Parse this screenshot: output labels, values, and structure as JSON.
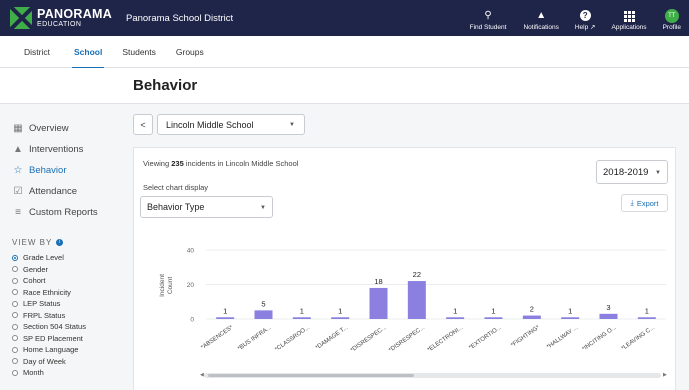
{
  "topbar": {
    "logo_main": "PANORAMA",
    "logo_sub": "EDUCATION",
    "district": "Panorama School District",
    "nav": [
      {
        "label": "Find Student",
        "icon": "search-icon"
      },
      {
        "label": "Notifications",
        "icon": "bell-icon"
      },
      {
        "label": "Help",
        "icon": "help-icon"
      },
      {
        "label": "Applications",
        "icon": "grid-icon"
      },
      {
        "label": "Profile",
        "icon": "avatar",
        "initials": "TT"
      }
    ]
  },
  "subnav": {
    "tabs": [
      "District",
      "School",
      "Students",
      "Groups"
    ],
    "active": "School"
  },
  "page": {
    "title": "Behavior"
  },
  "sidebar": {
    "items": [
      {
        "label": "Overview",
        "icon": "overview-icon"
      },
      {
        "label": "Interventions",
        "icon": "interventions-icon"
      },
      {
        "label": "Behavior",
        "icon": "star-icon",
        "active": true
      },
      {
        "label": "Attendance",
        "icon": "checkbox-icon"
      },
      {
        "label": "Custom Reports",
        "icon": "reports-icon"
      }
    ],
    "view_by_label": "VIEW BY",
    "view_by_options": [
      "Grade Level",
      "Gender",
      "Cohort",
      "Race Ethnicity",
      "LEP Status",
      "FRPL Status",
      "Section 504 Status",
      "SP ED Placement",
      "Home Language",
      "Day of Week",
      "Month"
    ],
    "view_by_selected": "Grade Level"
  },
  "controls": {
    "back": "<",
    "school": "Lincoln Middle School",
    "viewing_prefix": "Viewing",
    "viewing_count": "235",
    "viewing_suffix": "incidents in Lincoln Middle School",
    "select_label": "Select chart display",
    "chart_display": "Behavior Type",
    "year": "2018-2019",
    "export": "Export"
  },
  "colors": {
    "bar": "#8b7fe0",
    "accent": "#1a6fb5",
    "topbar": "#1f2449"
  },
  "chart_data": {
    "type": "bar",
    "ylabel": "Incident Count",
    "yticks": [
      0,
      20,
      40
    ],
    "ylim": [
      0,
      40
    ],
    "categories": [
      "*ABSENCES*",
      "*BUS INFRA...",
      "*CLASSROO...",
      "*DAMAGE T...",
      "*DISRESPEC...",
      "*DISRESPEC...",
      "*ELECTRONI...",
      "*EXTORTIO...",
      "*FIGHTING*",
      "*HALLWAY ...",
      "*INCITING O...",
      "*LEAVING C..."
    ],
    "values": [
      1,
      5,
      1,
      1,
      18,
      22,
      1,
      1,
      2,
      1,
      3,
      1
    ]
  }
}
